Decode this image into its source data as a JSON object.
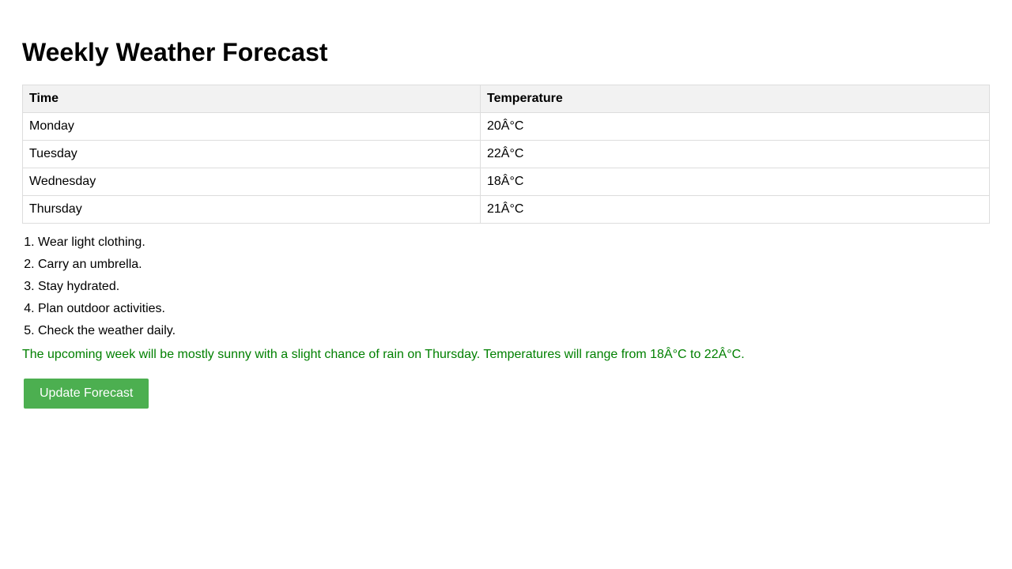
{
  "title": "Weekly Weather Forecast",
  "table": {
    "headers": [
      "Time",
      "Temperature"
    ],
    "rows": [
      {
        "day": "Monday",
        "temp": "20Â°C"
      },
      {
        "day": "Tuesday",
        "temp": "22Â°C"
      },
      {
        "day": "Wednesday",
        "temp": "18Â°C"
      },
      {
        "day": "Thursday",
        "temp": "21Â°C"
      }
    ]
  },
  "tips": [
    "Wear light clothing.",
    "Carry an umbrella.",
    "Stay hydrated.",
    "Plan outdoor activities.",
    "Check the weather daily."
  ],
  "summary": "The upcoming week will be mostly sunny with a slight chance of rain on Thursday. Temperatures will range from 18Â°C to 22Â°C.",
  "update_button_label": "Update Forecast",
  "colors": {
    "summary_text": "#008000",
    "button_bg": "#4caf50",
    "header_bg": "#f2f2f2"
  }
}
